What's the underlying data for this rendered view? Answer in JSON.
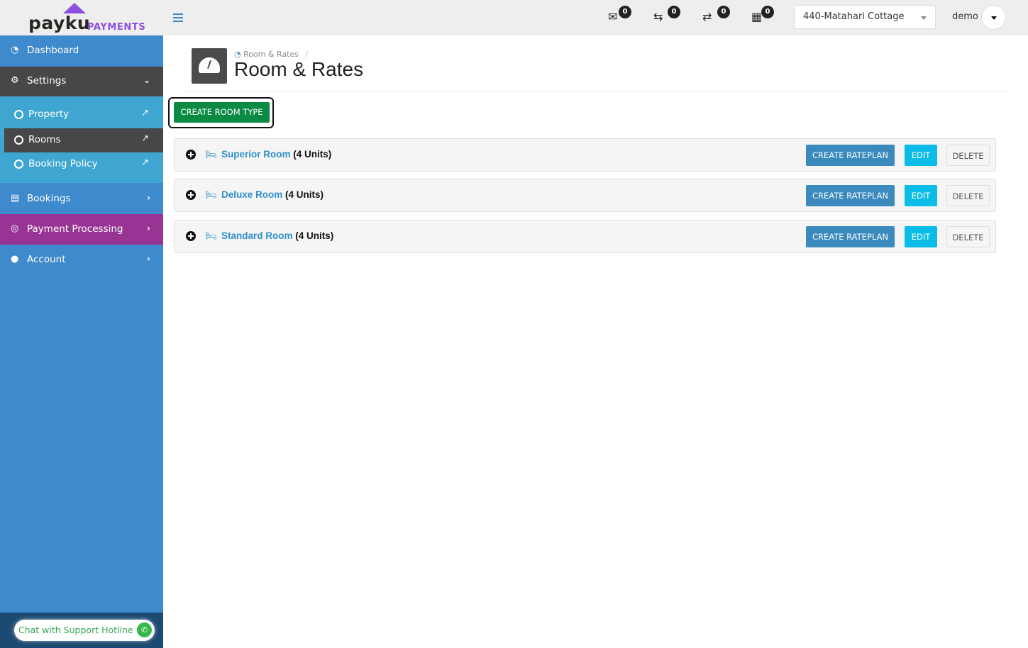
{
  "brand": {
    "name": "payku",
    "suffix": "PAYMENTS",
    "accent": "#8d4fe0"
  },
  "topbar": {
    "notifications": [
      {
        "icon": "envelope-open-icon",
        "count": "0"
      },
      {
        "icon": "check-in-icon",
        "count": "0"
      },
      {
        "icon": "check-out-icon",
        "count": "0"
      },
      {
        "icon": "calendar-icon",
        "count": "0"
      }
    ],
    "property_select": {
      "value": "440-Matahari Cottage"
    },
    "user": {
      "name": "demo"
    }
  },
  "sidebar": {
    "items": [
      {
        "label": "Dashboard",
        "icon": "dashboard-icon"
      },
      {
        "label": "Settings",
        "icon": "gear-icon",
        "expanded": true,
        "children": [
          {
            "label": "Property"
          },
          {
            "label": "Rooms",
            "active": true
          },
          {
            "label": "Booking Policy"
          }
        ]
      },
      {
        "label": "Bookings",
        "icon": "bookings-icon"
      },
      {
        "label": "Payment Processing",
        "icon": "payment-icon"
      },
      {
        "label": "Account",
        "icon": "user-icon"
      }
    ],
    "support": "Chat with Support Hotline"
  },
  "page": {
    "breadcrumb": "Room & Rates",
    "title": "Room & Rates",
    "create_button": "CREATE ROOM TYPE"
  },
  "rooms": [
    {
      "name": "Superior Room",
      "units": "(4 Units)"
    },
    {
      "name": "Deluxe Room",
      "units": "(4 Units)"
    },
    {
      "name": "Standard Room",
      "units": "(4 Units)"
    }
  ],
  "room_actions": {
    "create_rateplan": "CREATE RATEPLAN",
    "edit": "EDIT",
    "delete": "DELETE"
  }
}
